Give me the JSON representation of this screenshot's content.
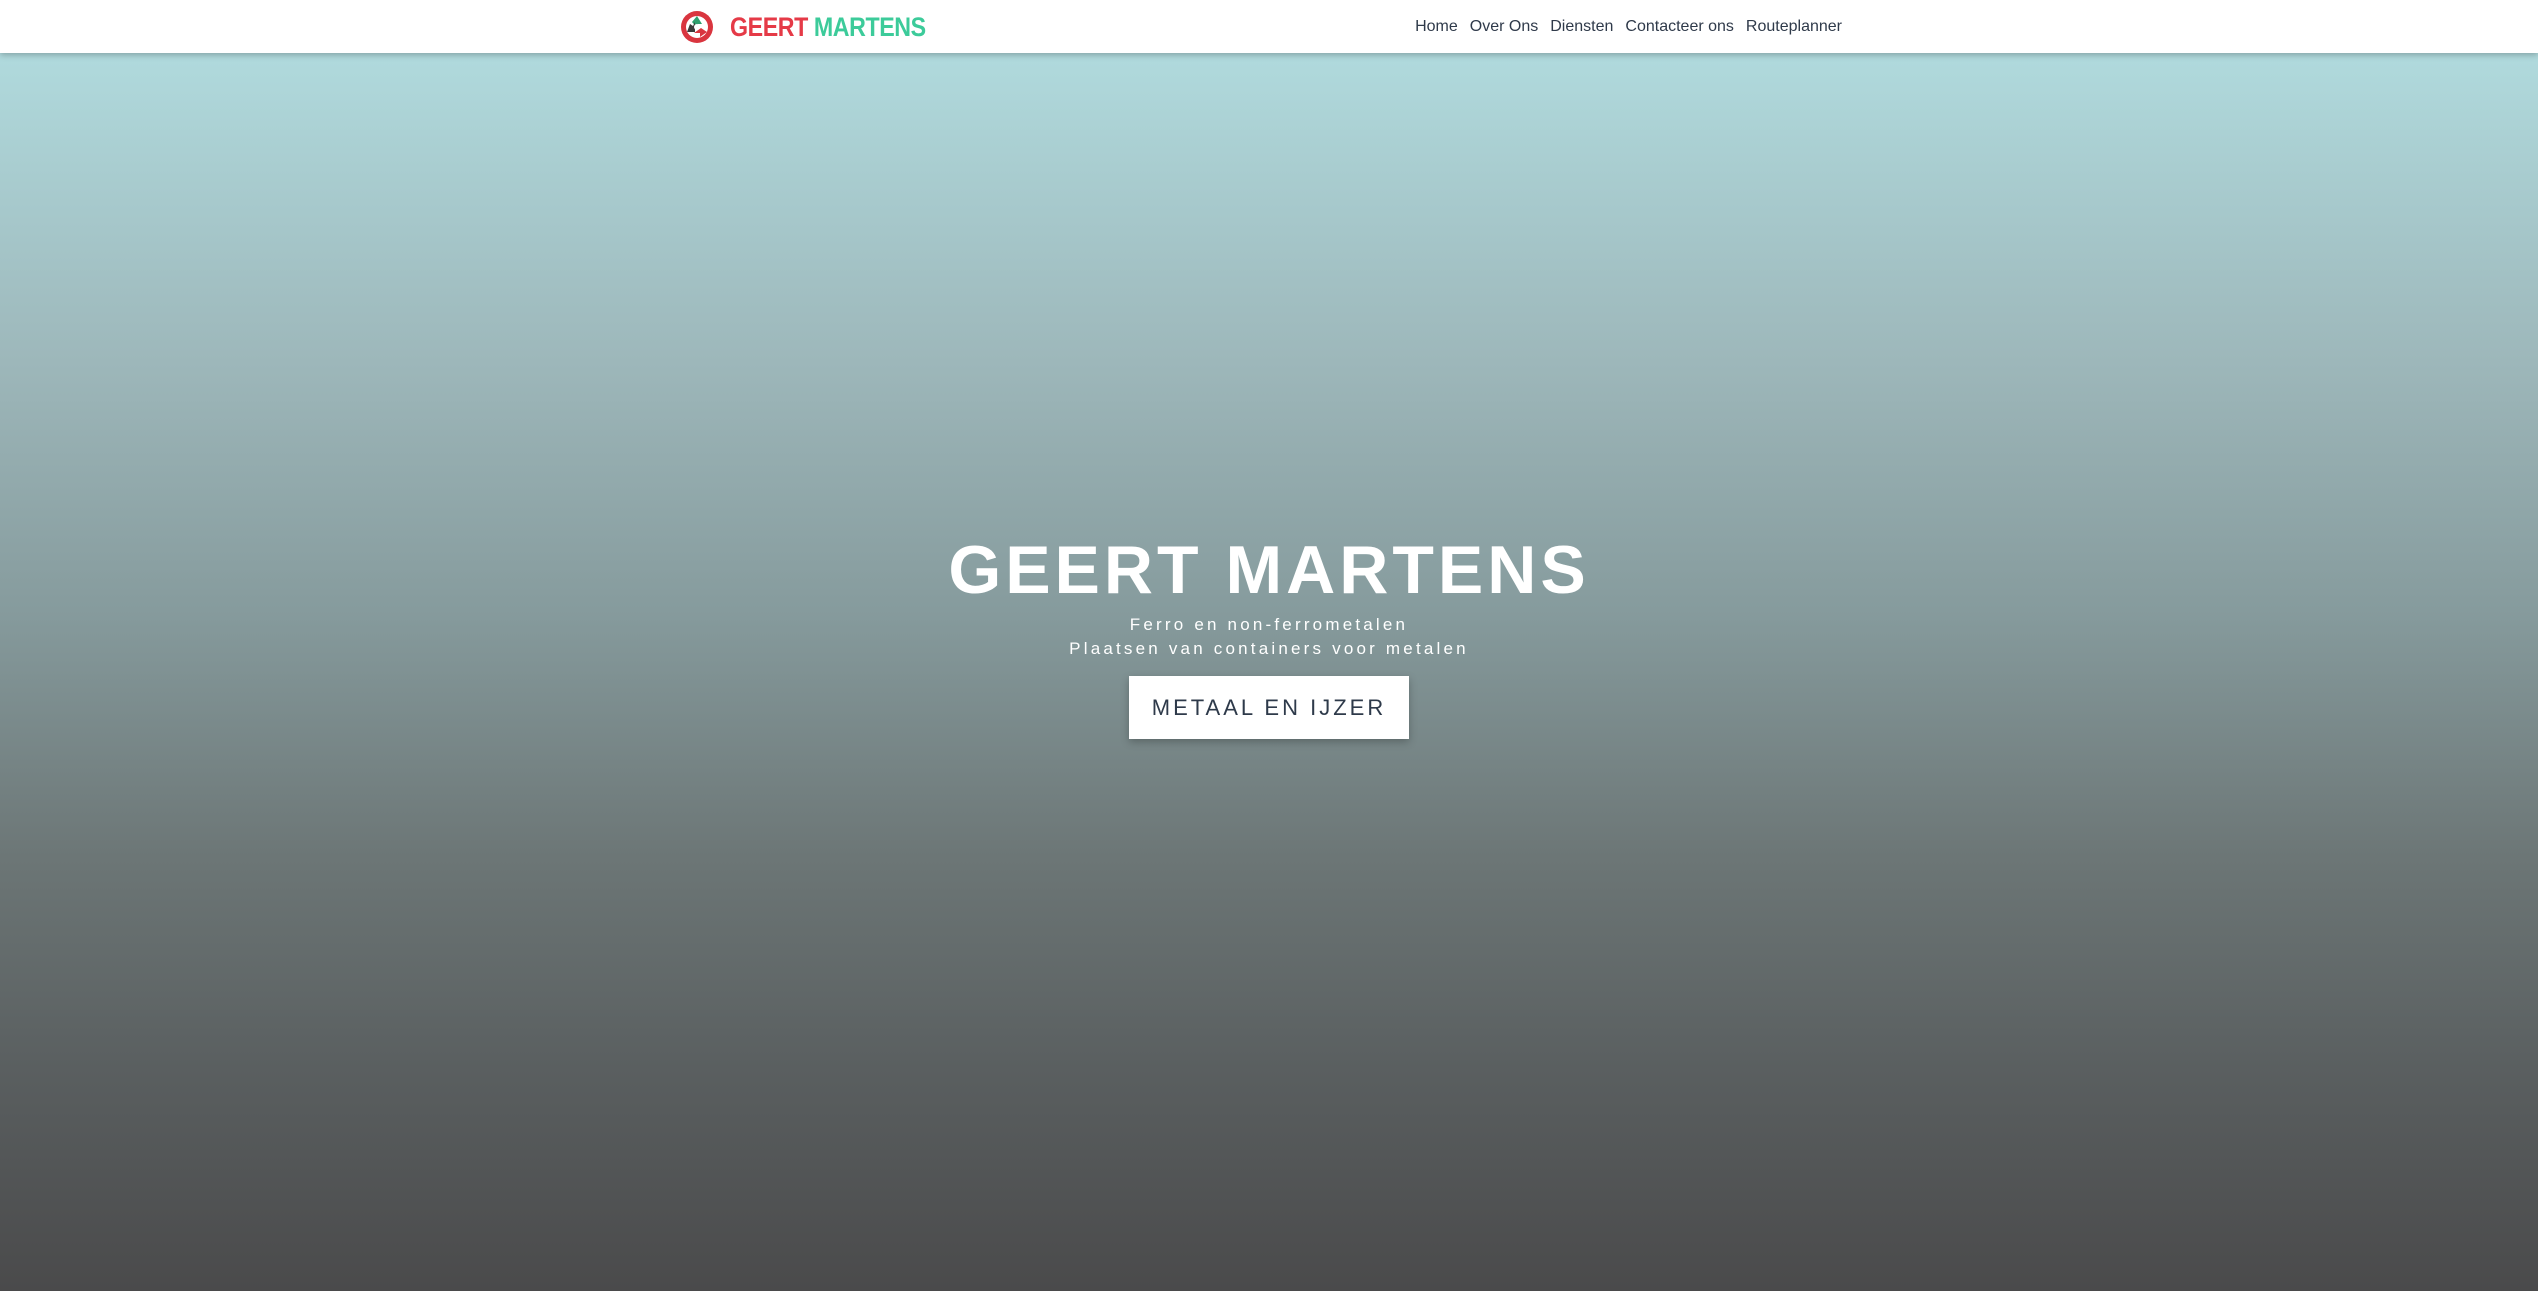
{
  "navbar": {
    "brand": {
      "logo_icon": "recycle-logo-icon",
      "name_part1": "GEERT",
      "name_part2": "MARTENS",
      "colors": {
        "part1": "#e53a47",
        "part2": "#3ccb9a"
      }
    },
    "menu": [
      {
        "label": "Home"
      },
      {
        "label": "Over Ons"
      },
      {
        "label": "Diensten"
      },
      {
        "label": "Contacteer ons"
      },
      {
        "label": "Routeplanner"
      }
    ]
  },
  "hero": {
    "title": "GEERT MARTENS",
    "subtitle_line1": "Ferro en non-ferrometalen",
    "subtitle_line2": "Plaatsen van containers voor metalen",
    "cta_label": "METAAL EN IJZER"
  }
}
